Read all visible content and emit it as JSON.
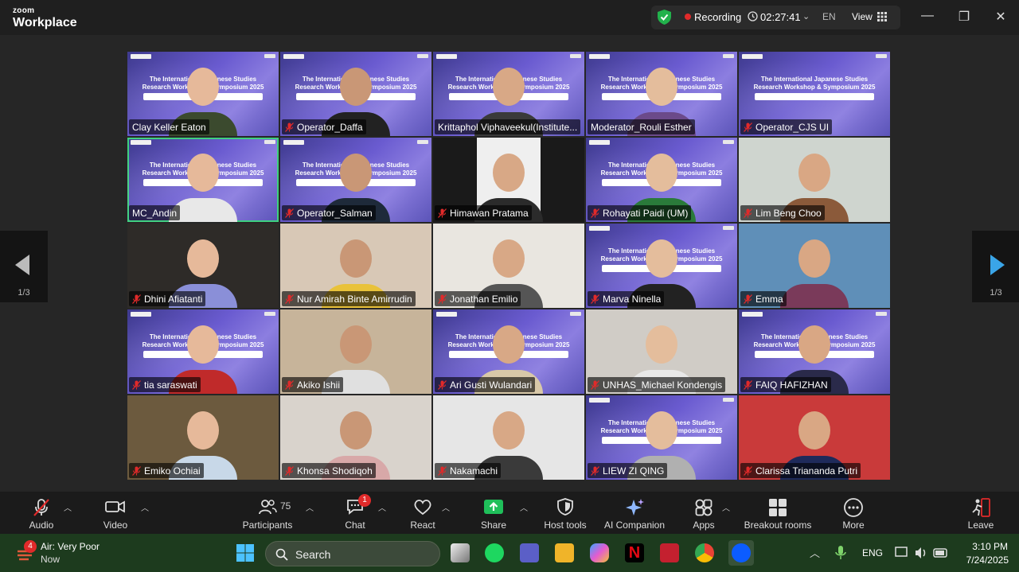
{
  "titlebar": {
    "brand_top": "zoom",
    "brand_bottom": "Workplace",
    "recording": "Recording",
    "timer": "02:27:41",
    "language": "EN",
    "view": "View"
  },
  "pager": {
    "left": "1/3",
    "right": "1/3"
  },
  "banner": {
    "line1": "The International Japanese Studies",
    "line2": "Research Workshop & Symposium 2025"
  },
  "participants": [
    {
      "name": "Clay Keller Eaton",
      "muted": false
    },
    {
      "name": "Operator_Daffa",
      "muted": true
    },
    {
      "name": "Krittaphol Viphaveekul(Institute...",
      "muted": false
    },
    {
      "name": "Moderator_Rouli Esther",
      "muted": false
    },
    {
      "name": "Operator_CJS UI",
      "muted": true
    },
    {
      "name": "MC_Andin",
      "muted": false
    },
    {
      "name": "Operator_Salman",
      "muted": true
    },
    {
      "name": "Himawan Pratama",
      "muted": true
    },
    {
      "name": "Rohayati Paidi (UM)",
      "muted": true
    },
    {
      "name": "Lim Beng Choo",
      "muted": true
    },
    {
      "name": "Dhini Afiatanti",
      "muted": true
    },
    {
      "name": "Nur Amirah Binte Amirrudin",
      "muted": true
    },
    {
      "name": "Jonathan Emilio",
      "muted": true
    },
    {
      "name": "Marva Ninella",
      "muted": true
    },
    {
      "name": "Emma",
      "muted": true
    },
    {
      "name": "tia saraswati",
      "muted": true
    },
    {
      "name": "Akiko Ishii",
      "muted": true
    },
    {
      "name": "Ari Gusti Wulandari",
      "muted": true
    },
    {
      "name": "UNHAS_Michael Kondengis",
      "muted": true
    },
    {
      "name": "FAIQ HAFIZHAN",
      "muted": true
    },
    {
      "name": "Emiko Ochiai",
      "muted": true
    },
    {
      "name": "Khonsa Shodiqoh",
      "muted": true
    },
    {
      "name": "Nakamachi",
      "muted": true
    },
    {
      "name": "LIEW ZI QING",
      "muted": true
    },
    {
      "name": "Clarissa Triananda Putri",
      "muted": true
    }
  ],
  "toolbar": {
    "audio": "Audio",
    "video": "Video",
    "participants": "Participants",
    "participants_count": "75",
    "chat": "Chat",
    "chat_badge": "1",
    "react": "React",
    "share": "Share",
    "host_tools": "Host tools",
    "ai_companion": "AI Companion",
    "apps": "Apps",
    "breakout_rooms": "Breakout rooms",
    "more": "More",
    "leave": "Leave"
  },
  "taskbar": {
    "weather_badge": "4",
    "weather_line1": "Air: Very Poor",
    "weather_line2": "Now",
    "search": "Search",
    "lang": "ENG",
    "time": "3:10 PM",
    "date": "7/24/2025"
  },
  "colors": {
    "active_speaker": "#3ed07f",
    "muted_red": "#e02a2a",
    "share_green": "#1fbf5a",
    "banner": "#6a5bd0"
  }
}
